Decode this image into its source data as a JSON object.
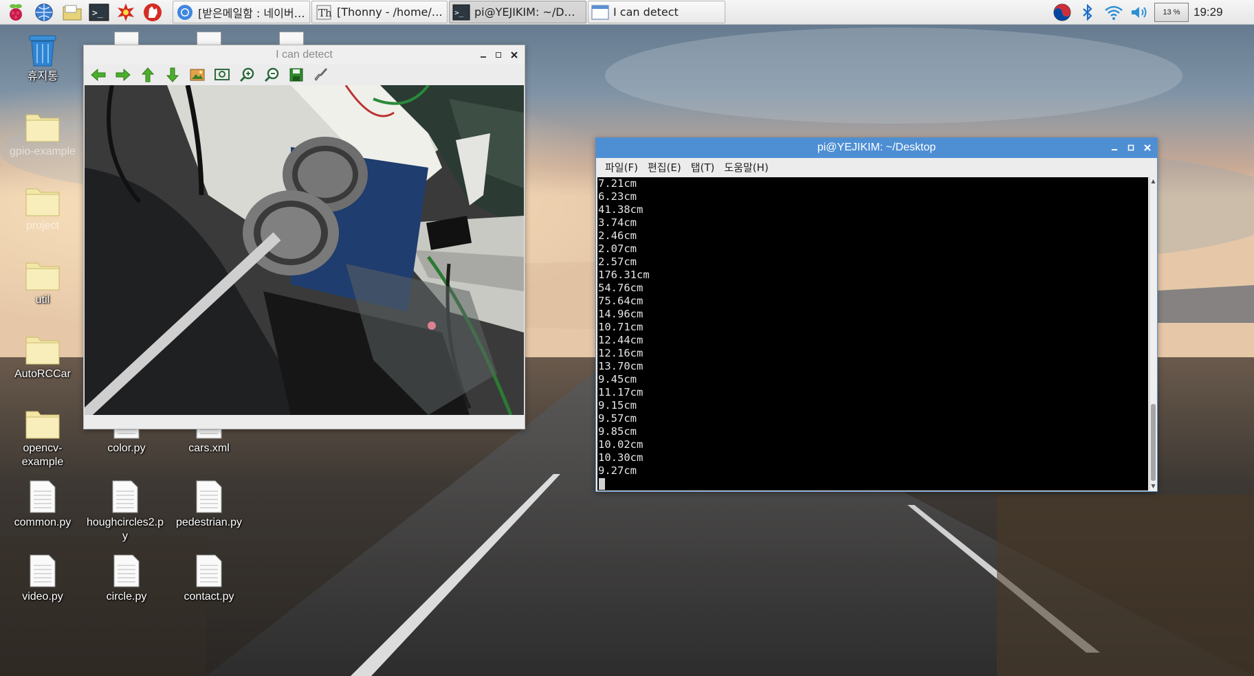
{
  "taskbar": {
    "launchers": [
      {
        "name": "raspberry-menu-icon"
      },
      {
        "name": "web-browser-icon"
      },
      {
        "name": "file-manager-icon"
      },
      {
        "name": "terminal-launcher-icon"
      },
      {
        "name": "math-app-icon"
      },
      {
        "name": "wolfram-icon"
      }
    ],
    "tasks": [
      {
        "label": "[받은메일함 : 네이버 ...",
        "icon": "chromium-icon",
        "active": false
      },
      {
        "label": "[Thonny  -  /home/pi/...",
        "icon": "thonny-icon",
        "active": false
      },
      {
        "label": "pi@YEJIKIM: ~/Deskt...",
        "icon": "terminal-icon",
        "active": true
      },
      {
        "label": "I can detect",
        "icon": "window-icon",
        "active": false
      }
    ],
    "tray": {
      "cpu": "13 %",
      "clock": "19:29"
    }
  },
  "desktop": {
    "icons": [
      {
        "label": "휴지통",
        "type": "trash"
      },
      {
        "label": "gpio-example",
        "type": "folder"
      },
      {
        "label": "project",
        "type": "folder"
      },
      {
        "label": "util",
        "type": "folder"
      },
      {
        "label": "AutoRCCar",
        "type": "folder"
      },
      {
        "label": "opencv-example",
        "type": "folder"
      },
      {
        "label": "color.py",
        "type": "file"
      },
      {
        "label": "cars.xml",
        "type": "file"
      },
      {
        "label": "common.py",
        "type": "file"
      },
      {
        "label": "houghcircles2.py",
        "type": "file"
      },
      {
        "label": "pedestrian.py",
        "type": "file"
      },
      {
        "label": "video.py",
        "type": "file"
      },
      {
        "label": "circle.py",
        "type": "file"
      },
      {
        "label": "contact.py",
        "type": "file"
      }
    ]
  },
  "viewer": {
    "title": "I can detect",
    "toolbar": [
      "back-arrow-icon",
      "forward-arrow-icon",
      "up-arrow-icon",
      "down-arrow-icon",
      "image-icon",
      "zoom-fit-icon",
      "zoom-in-icon",
      "zoom-out-icon",
      "save-icon",
      "brush-icon"
    ]
  },
  "terminal": {
    "title": "pi@YEJIKIM: ~/Desktop",
    "menu": [
      "파일(F)",
      "편집(E)",
      "탭(T)",
      "도움말(H)"
    ],
    "lines": [
      "7.21cm",
      "6.23cm",
      "41.38cm",
      "3.74cm",
      "2.46cm",
      "2.07cm",
      "2.57cm",
      "176.31cm",
      "54.76cm",
      "75.64cm",
      "14.96cm",
      "10.71cm",
      "12.44cm",
      "12.16cm",
      "13.70cm",
      "9.45cm",
      "11.17cm",
      "9.15cm",
      "9.57cm",
      "9.85cm",
      "10.02cm",
      "10.30cm",
      "9.27cm"
    ]
  },
  "colors": {
    "terminal_titlebar": "#4e8fd4",
    "terminal_bg": "#000000",
    "terminal_text": "#e6e6e6"
  }
}
